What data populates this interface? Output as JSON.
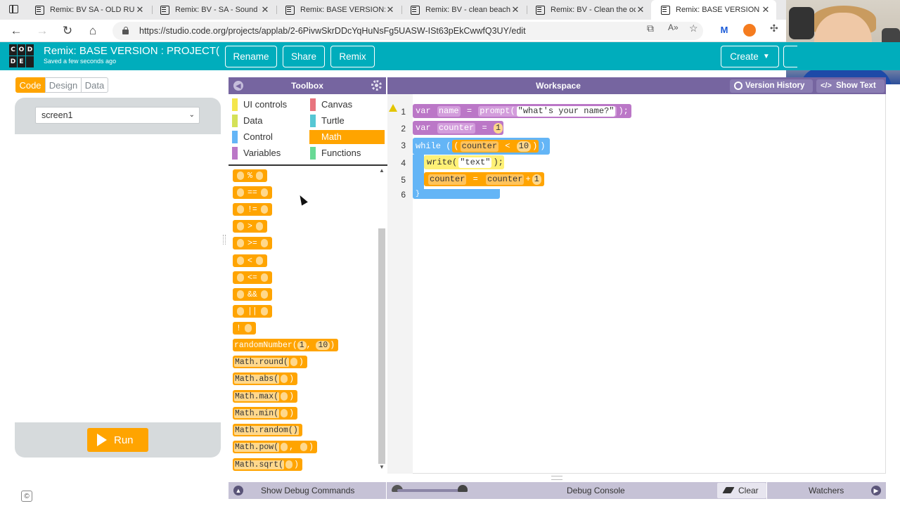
{
  "browser": {
    "tabs": [
      {
        "title": "Remix: BV SA - OLD RULER"
      },
      {
        "title": "Remix: BV - SA - Sound ech"
      },
      {
        "title": "Remix: BASE VERSION: Prin"
      },
      {
        "title": "Remix: BV - clean beach - A"
      },
      {
        "title": "Remix: BV - Clean the ocea"
      },
      {
        "title": "Remix: BASE VERSION : PRO"
      }
    ],
    "url": "https://studio.code.org/projects/applab/2-6PivwSkrDDcYqHuNsFg5UASW-ISt63pEkCwwfQ3UY/edit",
    "nav": {
      "back": "←",
      "forward": "→",
      "refresh": "↻",
      "home": "⌂"
    }
  },
  "header": {
    "logo_letters": [
      "C",
      "O",
      "D",
      "D",
      "E",
      ""
    ],
    "title": "Remix: BASE VERSION : PROJECT(...",
    "saved": "Saved a few seconds ago",
    "buttons": {
      "rename": "Rename",
      "share": "Share",
      "remix": "Remix",
      "create": "Create"
    },
    "accent_color": "#00adbc"
  },
  "left": {
    "modes": {
      "code": "Code",
      "design": "Design",
      "data": "Data"
    },
    "screen_select": "screen1",
    "run": "Run",
    "copyright": "©"
  },
  "toolbox": {
    "title": "Toolbox",
    "categories": [
      {
        "label": "UI controls",
        "color": "#f4e64c"
      },
      {
        "label": "Canvas",
        "color": "#e8747e"
      },
      {
        "label": "Data",
        "color": "#d4e157"
      },
      {
        "label": "Turtle",
        "color": "#56c7d4"
      },
      {
        "label": "Control",
        "color": "#64b5f6"
      },
      {
        "label": "Math",
        "color": "#ffa400"
      },
      {
        "label": "Variables",
        "color": "#bb77c7"
      },
      {
        "label": "Functions",
        "color": "#68d995"
      }
    ],
    "palette": {
      "ops": [
        "%",
        "==",
        "!=",
        ">",
        ">=",
        "<",
        "<=",
        "&&",
        "||",
        "!"
      ],
      "random_number": {
        "name": "randomNumber",
        "args": [
          "1",
          "10"
        ]
      },
      "math_fns": [
        "Math.round(",
        "Math.abs(",
        "Math.max(",
        "Math.min(",
        "Math.random()",
        "Math.pow(",
        "Math.sqrt("
      ]
    }
  },
  "workspace": {
    "title": "Workspace",
    "version_history": "Version History",
    "show_text": "Show Text",
    "line_numbers": [
      "1",
      "2",
      "3",
      "4",
      "5",
      "6"
    ],
    "code": {
      "l1": {
        "kw": "var",
        "name": "name",
        "eq": "=",
        "fn": "prompt",
        "str": "\"what's your name?\"",
        "end": ");"
      },
      "l2": {
        "kw": "var",
        "name": "counter",
        "eq": "=",
        "num": "1",
        "end": ";"
      },
      "l3": {
        "kw": "while",
        "paren": "(",
        "lhs": "counter",
        "op": "<",
        "num": "10",
        "end": ") {"
      },
      "l4": {
        "fn": "write(",
        "str": "\"text\"",
        "end": ");"
      },
      "l5": {
        "lhs": "counter",
        "eq": "=",
        "rhs": "counter",
        "op": "+",
        "num": "1",
        "end": ";"
      },
      "l6": {
        "close": "}"
      }
    }
  },
  "debug": {
    "show_commands": "Show Debug Commands",
    "console": "Debug Console",
    "clear": "Clear",
    "watchers": "Watchers"
  }
}
